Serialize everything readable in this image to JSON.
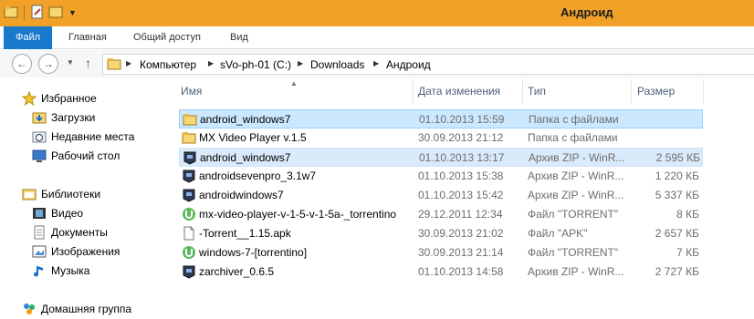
{
  "window": {
    "title": "Андроид",
    "accent": "#f1a128"
  },
  "ribbon": {
    "tabs": [
      {
        "label": "Файл"
      },
      {
        "label": "Главная"
      },
      {
        "label": "Общий доступ"
      },
      {
        "label": "Вид"
      }
    ]
  },
  "address": {
    "breadcrumbs": [
      "Компьютер",
      "sVo-ph-01 (C:)",
      "Downloads",
      "Андроид"
    ]
  },
  "nav": {
    "favorites": {
      "label": "Избранное",
      "items": [
        {
          "label": "Загрузки",
          "icon": "downloads-folder-icon"
        },
        {
          "label": "Недавние места",
          "icon": "recent-places-icon"
        },
        {
          "label": "Рабочий стол",
          "icon": "desktop-icon"
        }
      ]
    },
    "libraries": {
      "label": "Библиотеки",
      "items": [
        {
          "label": "Видео",
          "icon": "video-library-icon"
        },
        {
          "label": "Документы",
          "icon": "documents-library-icon"
        },
        {
          "label": "Изображения",
          "icon": "pictures-library-icon"
        },
        {
          "label": "Музыка",
          "icon": "music-library-icon"
        }
      ]
    },
    "homegroup": {
      "label": "Домашняя группа",
      "icon": "homegroup-icon"
    }
  },
  "columns": {
    "name": "Имя",
    "date": "Дата изменения",
    "type": "Тип",
    "size": "Размер"
  },
  "files": [
    {
      "name": "android_windows7",
      "date": "01.10.2013 15:59",
      "type": "Папка с файлами",
      "size": "",
      "icon": "folder-icon",
      "selected": "focus"
    },
    {
      "name": "MX Video Player v.1.5",
      "date": "30.09.2013 21:12",
      "type": "Папка с файлами",
      "size": "",
      "icon": "folder-icon"
    },
    {
      "name": "android_windows7",
      "date": "01.10.2013 13:17",
      "type": "Архив ZIP - WinR...",
      "size": "2 595 КБ",
      "icon": "winrar-archive-icon",
      "selected": "inactive"
    },
    {
      "name": "androidsevenpro_3.1w7",
      "date": "01.10.2013 15:38",
      "type": "Архив ZIP - WinR...",
      "size": "1 220 КБ",
      "icon": "winrar-archive-icon"
    },
    {
      "name": "androidwindows7",
      "date": "01.10.2013 15:42",
      "type": "Архив ZIP - WinR...",
      "size": "5 337 КБ",
      "icon": "winrar-archive-icon"
    },
    {
      "name": "mx-video-player-v-1-5-v-1-5a-_torrentino",
      "date": "29.12.2011 12:34",
      "type": "Файл \"TORRENT\"",
      "size": "8 КБ",
      "icon": "utorrent-icon"
    },
    {
      "name": "-Torrent__1.15.apk",
      "date": "30.09.2013 21:02",
      "type": "Файл \"APK\"",
      "size": "2 657 КБ",
      "icon": "blank-file-icon"
    },
    {
      "name": "windows-7-[torrentino]",
      "date": "30.09.2013 21:14",
      "type": "Файл \"TORRENT\"",
      "size": "7 КБ",
      "icon": "utorrent-icon"
    },
    {
      "name": "zarchiver_0.6.5",
      "date": "01.10.2013 14:58",
      "type": "Архив ZIP - WinR...",
      "size": "2 727 КБ",
      "icon": "winrar-archive-icon"
    }
  ]
}
